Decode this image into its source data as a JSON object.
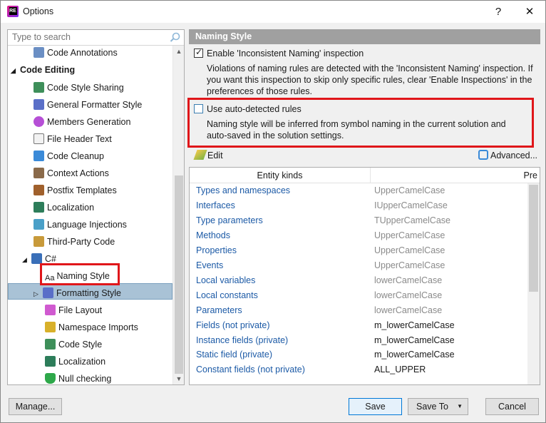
{
  "window": {
    "title": "Options",
    "help": "?",
    "close": "✕"
  },
  "search": {
    "placeholder": "Type to search"
  },
  "tree": {
    "items": [
      {
        "label": "Code Annotations"
      },
      {
        "label": "Code Editing"
      },
      {
        "label": "Code Style Sharing"
      },
      {
        "label": "General Formatter Style"
      },
      {
        "label": "Members Generation"
      },
      {
        "label": "File Header Text"
      },
      {
        "label": "Code Cleanup"
      },
      {
        "label": "Context Actions"
      },
      {
        "label": "Postfix Templates"
      },
      {
        "label": "Localization"
      },
      {
        "label": "Language Injections"
      },
      {
        "label": "Third-Party Code"
      },
      {
        "label": "C#"
      },
      {
        "label": "Naming Style",
        "icon_text": "Aa"
      },
      {
        "label": "Formatting Style"
      },
      {
        "label": "File Layout"
      },
      {
        "label": "Namespace Imports"
      },
      {
        "label": "Code Style"
      },
      {
        "label": "Localization"
      },
      {
        "label": "Null checking"
      }
    ]
  },
  "panel": {
    "header": "Naming Style",
    "enable_label": "Enable 'Inconsistent Naming' inspection",
    "enable_desc": "Violations of naming rules are detected with the 'Inconsistent Naming' inspection. If you want this inspection to skip only specific rules, clear 'Enable Inspections' in the preferences of those rules.",
    "auto_label": "Use auto-detected rules",
    "auto_desc": "Naming style will be inferred from symbol naming in the current solution and auto-saved in the solution settings.",
    "edit_label": "Edit",
    "advanced_label": "Advanced..."
  },
  "table": {
    "col_kinds": "Entity kinds",
    "col_pre": "Pre",
    "rows": [
      {
        "kind": "Types and namespaces",
        "style": "UpperCamelCase"
      },
      {
        "kind": "Interfaces",
        "style": "IUpperCamelCase"
      },
      {
        "kind": "Type parameters",
        "style": "TUpperCamelCase"
      },
      {
        "kind": "Methods",
        "style": "UpperCamelCase"
      },
      {
        "kind": "Properties",
        "style": "UpperCamelCase"
      },
      {
        "kind": "Events",
        "style": "UpperCamelCase"
      },
      {
        "kind": "Local variables",
        "style": "lowerCamelCase"
      },
      {
        "kind": "Local constants",
        "style": "lowerCamelCase"
      },
      {
        "kind": "Parameters",
        "style": "lowerCamelCase"
      },
      {
        "kind": "Fields (not private)",
        "style": "m_lowerCamelCase"
      },
      {
        "kind": "Instance fields (private)",
        "style": "m_lowerCamelCase"
      },
      {
        "kind": "Static field (private)",
        "style": "m_lowerCamelCase"
      },
      {
        "kind": "Constant fields (not private)",
        "style": "ALL_UPPER"
      }
    ]
  },
  "buttons": {
    "manage": "Manage...",
    "save": "Save",
    "save_to": "Save To",
    "cancel": "Cancel"
  },
  "colors": {
    "highlight_red": "#e0161a",
    "selection": "#a9c2d6",
    "link_blue": "#1c5aa6",
    "header_gray": "#a0a0a0"
  }
}
